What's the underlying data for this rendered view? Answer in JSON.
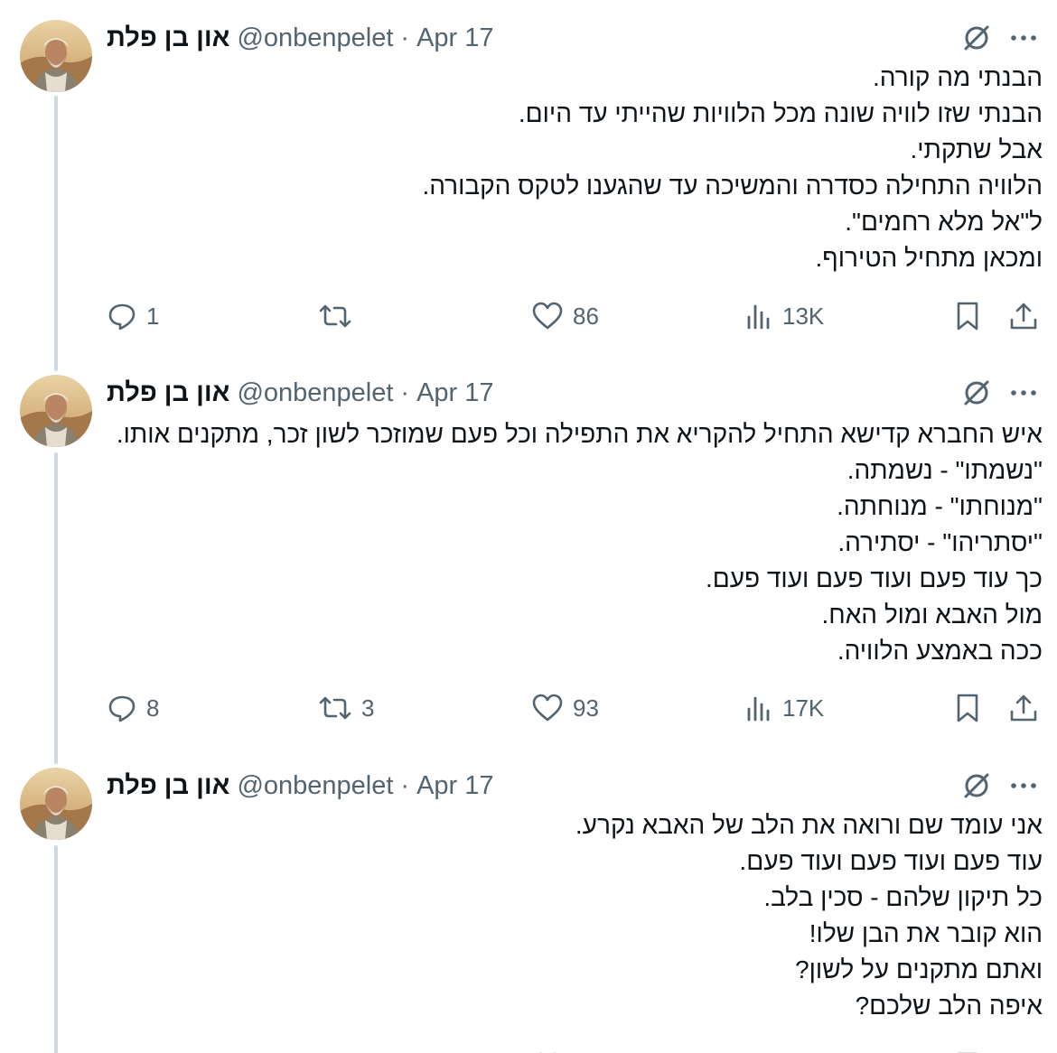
{
  "author": {
    "name": "און בן פלת",
    "handle": "@onbenpelet"
  },
  "separator": "·",
  "tweets": [
    {
      "date": "Apr 17",
      "lines": [
        "הבנתי מה קורה.",
        "הבנתי שזו לוויה שונה מכל הלוויות שהייתי עד היום.",
        "אבל שתקתי.",
        "הלוויה התחילה כסדרה והמשיכה עד שהגענו לטקס הקבורה.",
        "ל\"אל מלא רחמים\".",
        "ומכאן מתחיל הטירוף."
      ],
      "replies": "1",
      "reposts": "",
      "likes": "86",
      "views": "13K"
    },
    {
      "date": "Apr 17",
      "lines": [
        "איש החברא קדישא התחיל להקריא את התפילה וכל פעם שמוזכר לשון זכר, מתקנים אותו.",
        "\"נשמתו\" - נשמתה.",
        "\"מנוחתו\" - מנוחתה.",
        "\"יסתריהו\" - יסתירה.",
        "כך עוד פעם ועוד פעם ועוד פעם.",
        "מול האבא ומול האח.",
        "ככה באמצע הלוויה."
      ],
      "replies": "8",
      "reposts": "3",
      "likes": "93",
      "views": "17K"
    },
    {
      "date": "Apr 17",
      "lines": [
        "אני עומד שם ורואה את הלב של האבא נקרע.",
        "עוד פעם ועוד פעם ועוד פעם.",
        "כל תיקון שלהם -  סכין בלב.",
        "הוא קובר את הבן שלו!",
        "ואתם מתקנים על לשון?",
        "איפה הלב שלכם?"
      ],
      "replies": "",
      "reposts": "",
      "likes": "",
      "views": ""
    }
  ],
  "icons": [
    "grok-slash-icon",
    "more-icon",
    "reply-icon",
    "repost-icon",
    "like-icon",
    "views-icon",
    "bookmark-icon",
    "share-icon"
  ],
  "colors": {
    "text": "#0f1419",
    "secondary": "#536471",
    "thread_line": "#cfd9de"
  }
}
